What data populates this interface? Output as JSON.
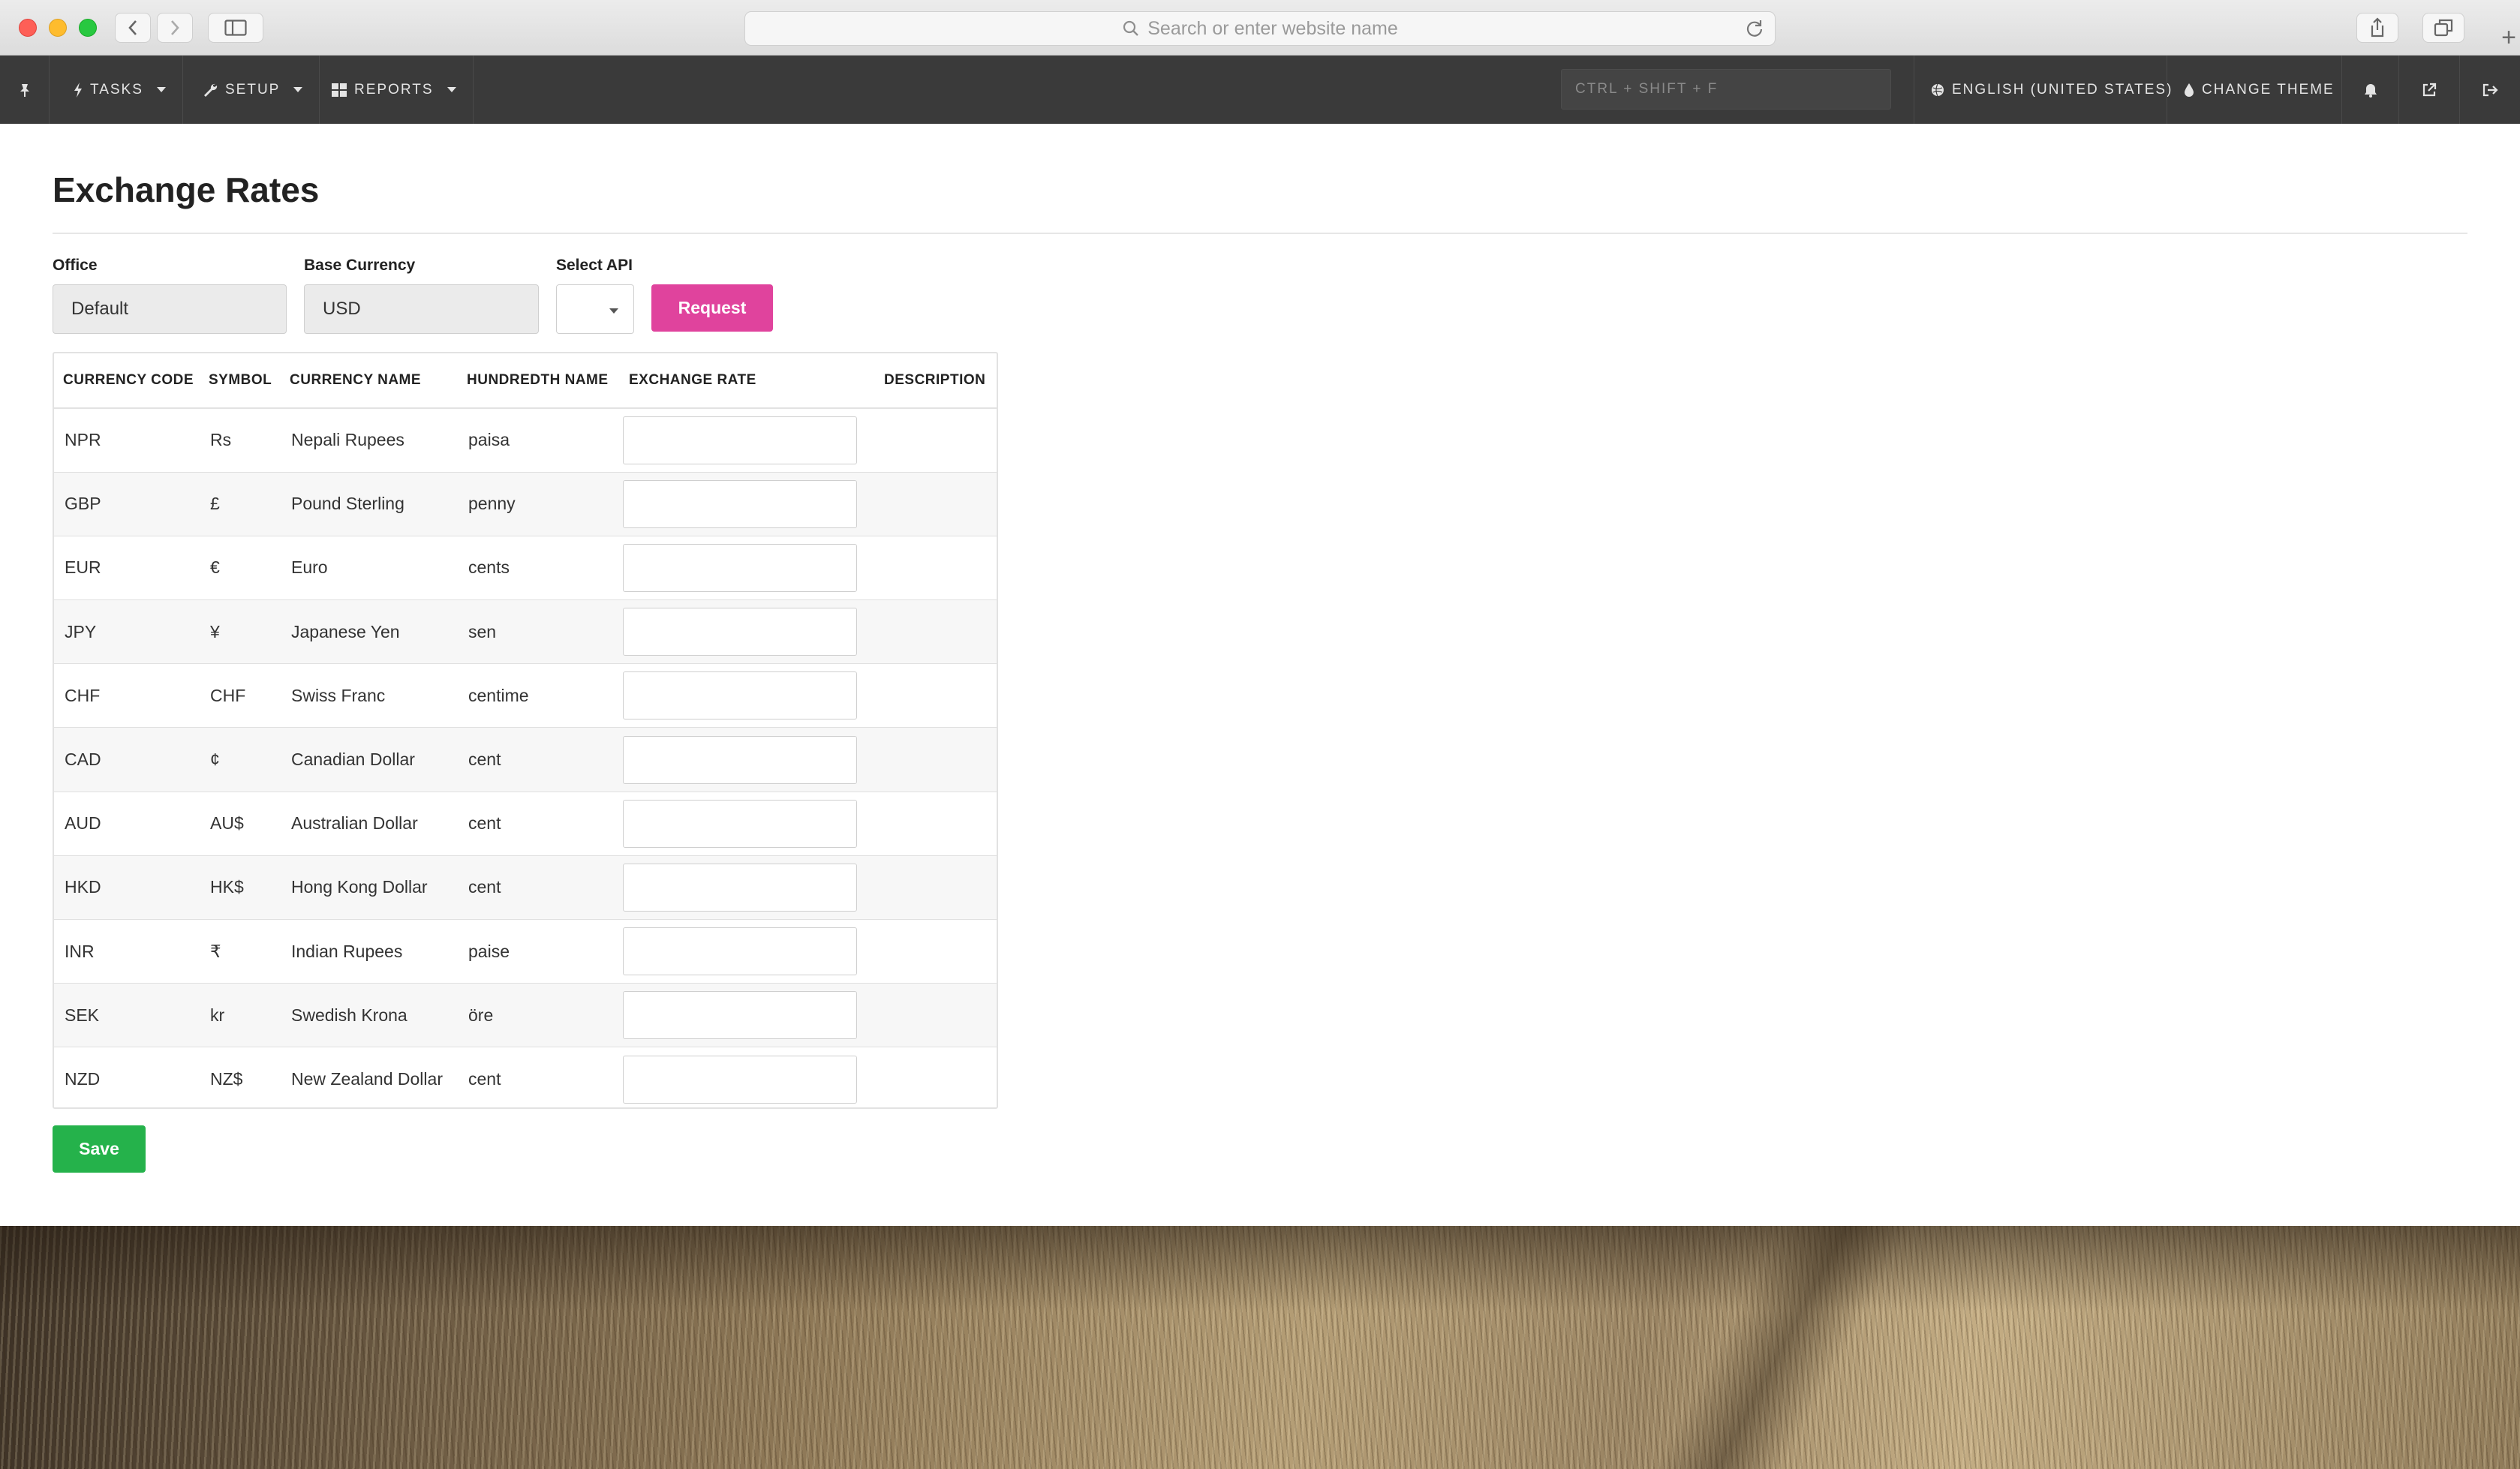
{
  "browser": {
    "url_placeholder": "Search or enter website name"
  },
  "appbar": {
    "tasks_label": "TASKS",
    "setup_label": "SETUP",
    "reports_label": "REPORTS",
    "search_placeholder": "CTRL + SHIFT + F",
    "language_label": "ENGLISH (UNITED STATES)",
    "theme_label": "CHANGE THEME"
  },
  "page": {
    "title": "Exchange Rates"
  },
  "form": {
    "office_label": "Office",
    "office_value": "Default",
    "base_currency_label": "Base Currency",
    "base_currency_value": "USD",
    "select_api_label": "Select API",
    "select_api_value": "",
    "request_label": "Request",
    "save_label": "Save"
  },
  "table": {
    "headers": [
      "CURRENCY CODE",
      "SYMBOL",
      "CURRENCY NAME",
      "HUNDREDTH NAME",
      "EXCHANGE RATE",
      "DESCRIPTION"
    ],
    "rows": [
      {
        "code": "NPR",
        "symbol": "Rs",
        "name": "Nepali Rupees",
        "hundredth": "paisa",
        "rate": "",
        "description": ""
      },
      {
        "code": "GBP",
        "symbol": "£",
        "name": "Pound Sterling",
        "hundredth": "penny",
        "rate": "",
        "description": ""
      },
      {
        "code": "EUR",
        "symbol": "€",
        "name": "Euro",
        "hundredth": "cents",
        "rate": "",
        "description": ""
      },
      {
        "code": "JPY",
        "symbol": "¥",
        "name": "Japanese Yen",
        "hundredth": "sen",
        "rate": "",
        "description": ""
      },
      {
        "code": "CHF",
        "symbol": "CHF",
        "name": "Swiss Franc",
        "hundredth": "centime",
        "rate": "",
        "description": ""
      },
      {
        "code": "CAD",
        "symbol": "¢",
        "name": "Canadian Dollar",
        "hundredth": "cent",
        "rate": "",
        "description": ""
      },
      {
        "code": "AUD",
        "symbol": "AU$",
        "name": "Australian Dollar",
        "hundredth": "cent",
        "rate": "",
        "description": ""
      },
      {
        "code": "HKD",
        "symbol": "HK$",
        "name": "Hong Kong Dollar",
        "hundredth": "cent",
        "rate": "",
        "description": ""
      },
      {
        "code": "INR",
        "symbol": "₹",
        "name": "Indian Rupees",
        "hundredth": "paise",
        "rate": "",
        "description": ""
      },
      {
        "code": "SEK",
        "symbol": "kr",
        "name": "Swedish Krona",
        "hundredth": "öre",
        "rate": "",
        "description": ""
      },
      {
        "code": "NZD",
        "symbol": "NZ$",
        "name": "New Zealand Dollar",
        "hundredth": "cent",
        "rate": "",
        "description": ""
      }
    ]
  },
  "colors": {
    "appbar_bg": "#3a3a3a",
    "request_button": "#e0439d",
    "save_button": "#25b24b"
  }
}
